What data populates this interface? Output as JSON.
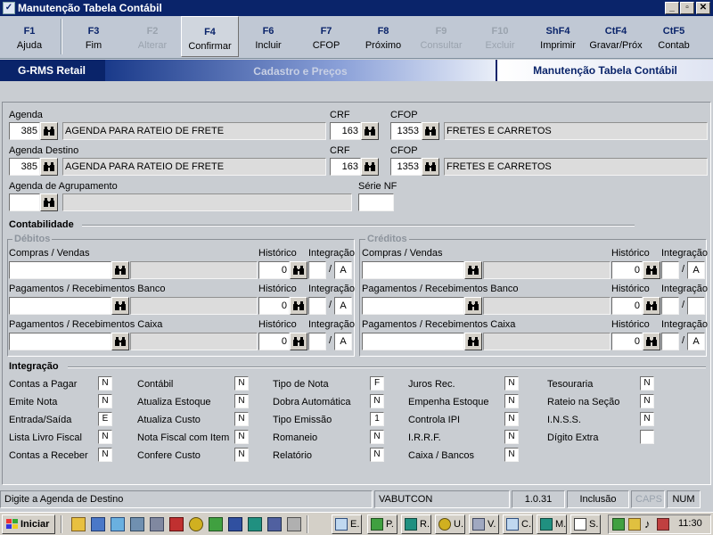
{
  "window": {
    "title": "Manutenção Tabela Contábil",
    "icon_glyph": "✓"
  },
  "window_buttons": {
    "min": "_",
    "max": "▫",
    "close": "✕"
  },
  "toolbar": [
    {
      "key": "F1",
      "label": "Ajuda",
      "enabled": true
    },
    {
      "key": "F3",
      "label": "Fim",
      "enabled": true
    },
    {
      "key": "F2",
      "label": "Alterar",
      "enabled": false
    },
    {
      "key": "F4",
      "label": "Confirmar",
      "enabled": true,
      "selected": true
    },
    {
      "key": "F6",
      "label": "Incluir",
      "enabled": true
    },
    {
      "key": "F7",
      "label": "CFOP",
      "enabled": true
    },
    {
      "key": "F8",
      "label": "Próximo",
      "enabled": true
    },
    {
      "key": "F9",
      "label": "Consultar",
      "enabled": false
    },
    {
      "key": "F10",
      "label": "Excluir",
      "enabled": false
    },
    {
      "key": "ShF4",
      "label": "Imprimir",
      "enabled": true
    },
    {
      "key": "CtF4",
      "label": "Gravar/Próx",
      "enabled": true
    },
    {
      "key": "CtF5",
      "label": "Contab",
      "enabled": true
    }
  ],
  "banner": {
    "left": "G-RMS Retail",
    "middle": "Cadastro e Preços",
    "right": "Manutenção Tabela Contábil"
  },
  "form": {
    "agenda": {
      "label": "Agenda",
      "code": "385",
      "desc": "AGENDA PARA RATEIO DE FRETE"
    },
    "crf1": {
      "label": "CRF",
      "value": "163"
    },
    "cfop1": {
      "label": "CFOP",
      "code": "1353",
      "desc": "FRETES E CARRETOS"
    },
    "agenda_destino": {
      "label": "Agenda Destino",
      "code": "385",
      "desc": "AGENDA PARA RATEIO DE FRETE"
    },
    "crf2": {
      "label": "CRF",
      "value": "163"
    },
    "cfop2": {
      "label": "CFOP",
      "code": "1353",
      "desc": "FRETES E CARRETOS"
    },
    "agrupamento": {
      "label": "Agenda de Agrupamento",
      "code": "",
      "desc": ""
    },
    "serie_nf": {
      "label": "Série NF",
      "value": ""
    }
  },
  "contabilidade": {
    "title": "Contabilidade",
    "debitos": {
      "title": "Débitos",
      "rows": [
        {
          "label": "Compras / Vendas",
          "historico": "0",
          "integracao": "A"
        },
        {
          "label": "Pagamentos / Recebimentos Banco",
          "historico": "0",
          "integracao": "A"
        },
        {
          "label": "Pagamentos / Recebimentos Caixa",
          "historico": "0",
          "integracao": "A"
        }
      ]
    },
    "creditos": {
      "title": "Créditos",
      "rows": [
        {
          "label": "Compras / Vendas",
          "historico": "0",
          "integracao": "A"
        },
        {
          "label": "Pagamentos / Recebimentos Banco",
          "historico": "0",
          "integracao": ""
        },
        {
          "label": "Pagamentos / Recebimentos Caixa",
          "historico": "0",
          "integracao": "A"
        }
      ]
    },
    "historico_label": "Histórico",
    "integracao_label": "Integração",
    "slash": "/"
  },
  "integracao": {
    "title": "Integração",
    "columns": [
      [
        {
          "label": "Contas a Pagar",
          "value": "N"
        },
        {
          "label": "Emite Nota",
          "value": "N"
        },
        {
          "label": "Entrada/Saída",
          "value": "E"
        },
        {
          "label": "Lista Livro Fiscal",
          "value": "N"
        },
        {
          "label": "Contas a Receber",
          "value": "N"
        }
      ],
      [
        {
          "label": "Contábil",
          "value": "N"
        },
        {
          "label": "Atualiza Estoque",
          "value": "N"
        },
        {
          "label": "Atualiza Custo",
          "value": "N"
        },
        {
          "label": "Nota Fiscal com Item",
          "value": "N"
        },
        {
          "label": "Confere Custo",
          "value": "N"
        }
      ],
      [
        {
          "label": "Tipo de Nota",
          "value": "F"
        },
        {
          "label": "Dobra Automática",
          "value": "N"
        },
        {
          "label": "Tipo Emissão",
          "value": "1"
        },
        {
          "label": "Romaneio",
          "value": "N"
        },
        {
          "label": "Relatório",
          "value": "N"
        }
      ],
      [
        {
          "label": "Juros Rec.",
          "value": "N"
        },
        {
          "label": "Empenha Estoque",
          "value": "N"
        },
        {
          "label": "Controla IPI",
          "value": "N"
        },
        {
          "label": "I.R.R.F.",
          "value": "N"
        },
        {
          "label": "Caixa / Bancos",
          "value": "N"
        }
      ],
      [
        {
          "label": "Tesouraria",
          "value": "N"
        },
        {
          "label": "Rateio na Seção",
          "value": "N"
        },
        {
          "label": "I.N.S.S.",
          "value": "N"
        },
        {
          "label": "Dígito Extra",
          "value": ""
        }
      ]
    ]
  },
  "status": {
    "message": "Digite a Agenda de Destino",
    "user": "VABUTCON",
    "version": "1.0.31",
    "mode": "Inclusão",
    "caps": "CAPS",
    "num": "NUM"
  },
  "taskbar": {
    "start": "Iniciar",
    "buttons": [
      "E.",
      "P.",
      "R.",
      "U.",
      "V.",
      "C.",
      "M.",
      "S."
    ],
    "clock": "11:30"
  },
  "colors": {
    "title": "#0a246a",
    "disabled": "#9aa3ae",
    "panel": "#c9cdd2"
  }
}
